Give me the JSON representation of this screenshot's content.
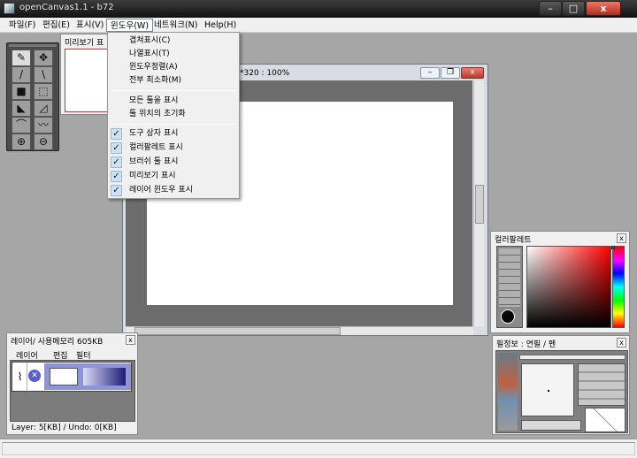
{
  "app": {
    "title": "openCanvas1.1 - b72"
  },
  "window_controls": {
    "minimize": "–",
    "maximize": "□",
    "close": "x"
  },
  "menubar": {
    "items": [
      "파일(F)",
      "편집(E)",
      "표시(V)",
      "윈도우(W)",
      "네트워크(N)",
      "Help(H)"
    ]
  },
  "dropdown": {
    "items": [
      {
        "label": "겹쳐표시(C)",
        "checked": false
      },
      {
        "label": "나열표시(T)",
        "checked": false
      },
      {
        "label": "윈도우정렬(A)",
        "checked": false
      },
      {
        "label": "전부 최소화(M)",
        "checked": false
      },
      {
        "label": "모든 툴을 표시",
        "checked": false
      },
      {
        "label": "툴 위치의 초기화",
        "checked": false
      },
      {
        "label": "도구 상자 표시",
        "checked": true
      },
      {
        "label": "컬러팔레트 표시",
        "checked": true
      },
      {
        "label": "브러쉬 툴 표시",
        "checked": true
      },
      {
        "label": "미리보기 표시",
        "checked": true
      },
      {
        "label": "레이어 윈도우 표시",
        "checked": true
      }
    ],
    "check_mark": "✓"
  },
  "preview_panel": {
    "title": "미리보기 표"
  },
  "canvas_window": {
    "title": "*320 : 100%"
  },
  "color_panel": {
    "title": "컬러팔레트",
    "close": "x",
    "fg_color": "#000000",
    "hue_marker_color": "#ff0000"
  },
  "brush_panel": {
    "title": "필정보 : 연필  /  펜",
    "close": "x"
  },
  "layer_panel": {
    "title": "레이어/ 사용메모리 605KB",
    "close": "x",
    "tabs": [
      "레이어",
      "편집",
      "필터"
    ],
    "status": "Layer: 5[KB] / Undo: 0[KB]"
  },
  "toolbox": {
    "tools": [
      {
        "icon": "pencil-icon",
        "glyph": "✎"
      },
      {
        "icon": "move-icon",
        "glyph": "✥"
      },
      {
        "icon": "eyedropper-icon",
        "glyph": "/"
      },
      {
        "icon": "line-icon",
        "glyph": "\\"
      },
      {
        "icon": "fill-rect-icon",
        "glyph": "■"
      },
      {
        "icon": "select-rect-icon",
        "glyph": "⬚"
      },
      {
        "icon": "lasso-fill-icon",
        "glyph": "◣"
      },
      {
        "icon": "lasso-icon",
        "glyph": "◿"
      },
      {
        "icon": "curve-icon",
        "glyph": "⌒"
      },
      {
        "icon": "freehand-icon",
        "glyph": "〰"
      },
      {
        "icon": "zoom-in-icon",
        "glyph": "⊕"
      },
      {
        "icon": "zoom-out-icon",
        "glyph": "⊖"
      }
    ]
  }
}
